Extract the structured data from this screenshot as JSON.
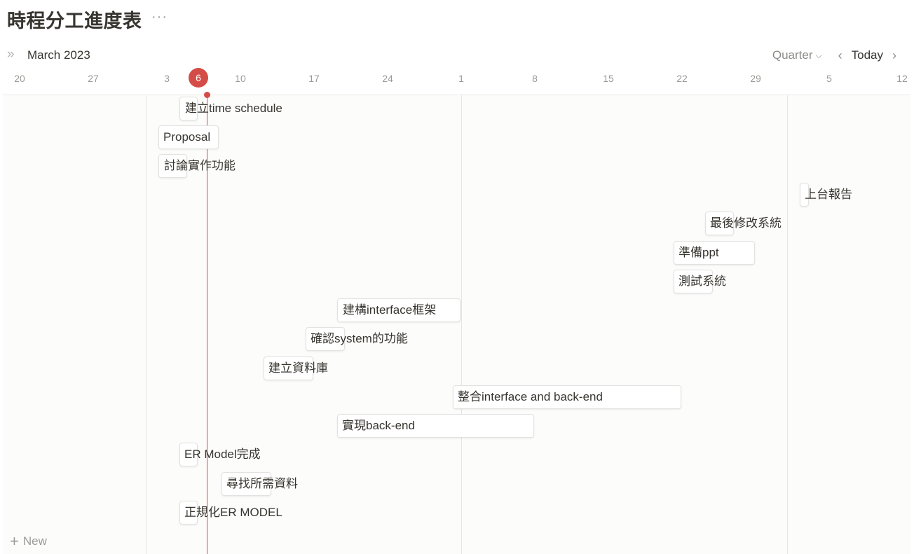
{
  "header": {
    "title": "時程分工進度表",
    "more_label": "···"
  },
  "toolbar": {
    "toggle_icon": "»",
    "month": "March 2023",
    "period": "Quarter",
    "period_icon": "chevron-down-icon",
    "prev": "‹",
    "today": "Today",
    "next": "›"
  },
  "dates": [
    "20",
    "27",
    "3",
    "6",
    "10",
    "17",
    "24",
    "1",
    "8",
    "15",
    "22",
    "29",
    "5",
    "12"
  ],
  "today_date": "6",
  "tasks": [
    {
      "name": "建立time schedule"
    },
    {
      "name": "Proposal"
    },
    {
      "name": "討論實作功能"
    },
    {
      "name": "上台報告"
    },
    {
      "name": "最後修改系統"
    },
    {
      "name": "準備ppt"
    },
    {
      "name": "測試系統"
    },
    {
      "name": "建構interface框架"
    },
    {
      "name": "確認system的功能"
    },
    {
      "name": "建立資料庫"
    },
    {
      "name": "整合interface and back-end"
    },
    {
      "name": "實現back-end"
    },
    {
      "name": "ER Model完成"
    },
    {
      "name": "尋找所需資料"
    },
    {
      "name": "正規化ER MODEL"
    }
  ],
  "footer": {
    "new_label": "New"
  }
}
